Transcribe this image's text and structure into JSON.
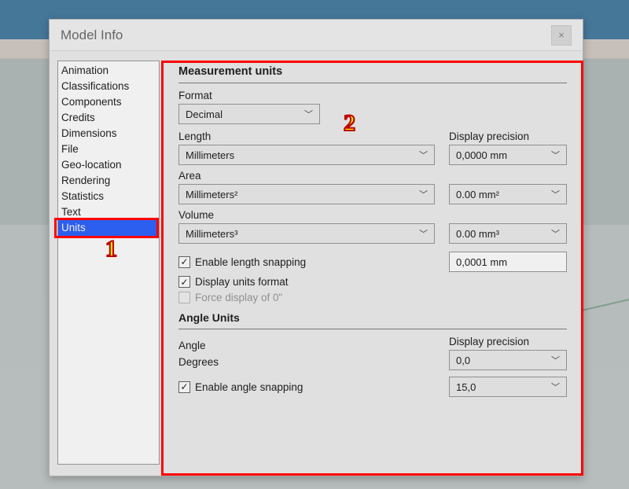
{
  "window": {
    "title": "Model Info",
    "close_glyph": "×"
  },
  "sidebar": {
    "items": [
      "Animation",
      "Classifications",
      "Components",
      "Credits",
      "Dimensions",
      "File",
      "Geo-location",
      "Rendering",
      "Statistics",
      "Text",
      "Units"
    ],
    "selected": "Units"
  },
  "content": {
    "section1_heading": "Measurement units",
    "format": {
      "label": "Format",
      "value": "Decimal"
    },
    "length": {
      "label": "Length",
      "value": "Millimeters"
    },
    "precision_label": "Display precision",
    "length_precision": "0,0000 mm",
    "area": {
      "label": "Area",
      "value": "Millimeters²",
      "precision": "0.00 mm²"
    },
    "volume": {
      "label": "Volume",
      "value": "Millimeters³",
      "precision": "0.00 mm³"
    },
    "chk_length_snap": {
      "label": "Enable length snapping",
      "checked": true
    },
    "length_snap_value": "0,0001 mm",
    "chk_units_format": {
      "label": "Display units format",
      "checked": true
    },
    "chk_force_0": {
      "label": "Force display of 0\"",
      "checked": false,
      "disabled": true
    },
    "section2_heading": "Angle Units",
    "angle": {
      "label": "Angle",
      "value": "Degrees",
      "precision": "0,0"
    },
    "chk_angle_snap": {
      "label": "Enable angle snapping",
      "checked": true
    },
    "angle_snap_value": "15,0"
  },
  "annotations": {
    "one": "1",
    "two": "2"
  }
}
